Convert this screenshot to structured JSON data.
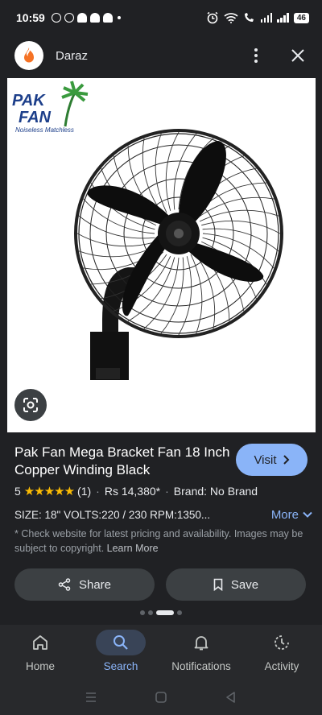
{
  "status_bar": {
    "time": "10:59",
    "battery": "46"
  },
  "header": {
    "site_name": "Daraz"
  },
  "image": {
    "brand_logo_line1": "PAK",
    "brand_logo_line2": "FAN",
    "brand_tagline": "Noiseless Matchless"
  },
  "product": {
    "title": "Pak Fan Mega Bracket Fan 18 Inch Copper Winding Black",
    "rating": "5",
    "stars": "★★★★★",
    "review_count": "(1)",
    "separator": "·",
    "price": "Rs 14,380*",
    "brand": "Brand: No Brand",
    "specs": "SIZE: 18\" VOLTS:220 / 230 RPM:1350...",
    "more_label": "More",
    "visit_label": "Visit",
    "disclaimer": "* Check website for latest pricing and availability. Images may be subject to copyright.",
    "learn_more": "Learn More"
  },
  "actions": {
    "share_label": "Share",
    "save_label": "Save"
  },
  "bottom_nav": {
    "items": [
      {
        "label": "Home"
      },
      {
        "label": "Search"
      },
      {
        "label": "Notifications"
      },
      {
        "label": "Activity"
      }
    ]
  },
  "colors": {
    "accent": "#8ab4f8",
    "star": "#fbbc04",
    "background": "#202124",
    "daraz_orange": "#f57224"
  }
}
